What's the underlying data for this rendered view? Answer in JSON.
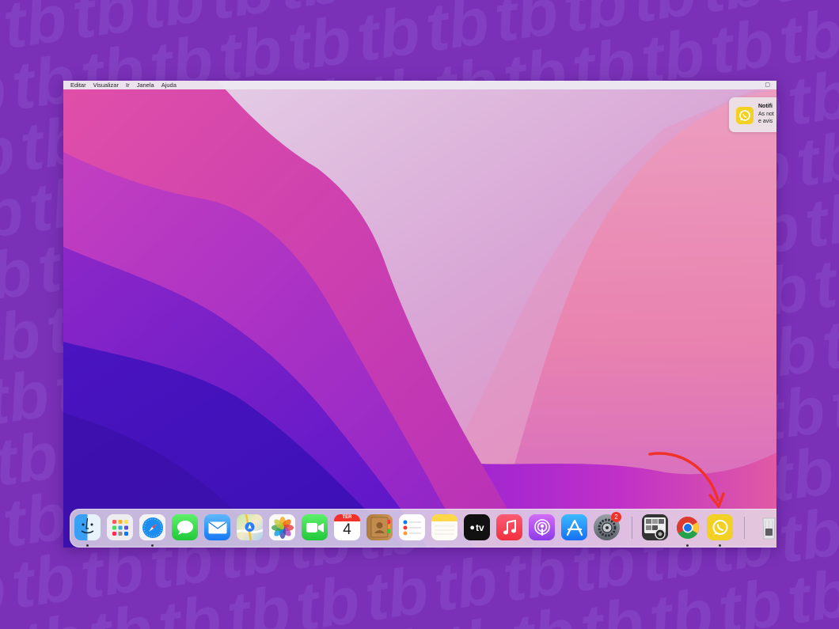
{
  "menubar": {
    "items": [
      "Editar",
      "Visualizar",
      "Ir",
      "Janela",
      "Ajuda"
    ]
  },
  "notification": {
    "title": "Notifi",
    "body": "As not\ne avis",
    "app_icon": "whatsapp-icon"
  },
  "dock": {
    "apps": [
      {
        "name": "finder-icon",
        "running": true
      },
      {
        "name": "launchpad-icon",
        "running": false
      },
      {
        "name": "safari-icon",
        "running": true
      },
      {
        "name": "messages-icon",
        "running": false
      },
      {
        "name": "mail-icon",
        "running": false
      },
      {
        "name": "maps-icon",
        "running": false
      },
      {
        "name": "photos-icon",
        "running": false
      },
      {
        "name": "facetime-icon",
        "running": false
      },
      {
        "name": "calendar-icon",
        "running": false
      },
      {
        "name": "contacts-icon",
        "running": false
      },
      {
        "name": "reminders-icon",
        "running": false
      },
      {
        "name": "notes-icon",
        "running": false
      },
      {
        "name": "apple-tv-icon",
        "running": false
      },
      {
        "name": "music-icon",
        "running": false
      },
      {
        "name": "podcasts-icon",
        "running": false
      },
      {
        "name": "app-store-icon",
        "running": false
      },
      {
        "name": "system-preferences-icon",
        "running": false
      },
      {
        "name": "image-capture-icon",
        "running": false
      },
      {
        "name": "chrome-icon",
        "running": true
      },
      {
        "name": "whatsapp-icon",
        "running": true
      },
      {
        "name": "trash-icon",
        "running": false
      }
    ],
    "calendar": {
      "month": "TER",
      "day": "4"
    },
    "appletv_label": "tv",
    "system_preferences_badge": "2"
  },
  "colors": {
    "background": "#7a31b8",
    "pattern": "#8a43c6",
    "annotation_arrow": "#f0322a",
    "whatsapp_yellow": "#f2d024"
  }
}
